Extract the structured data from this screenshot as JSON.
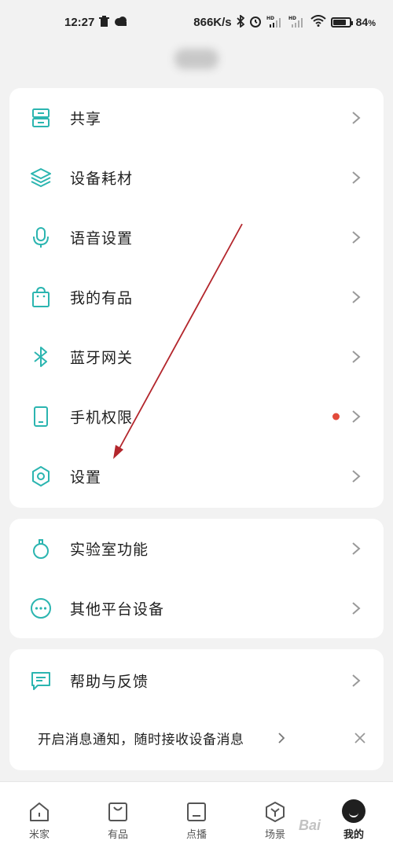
{
  "status_bar": {
    "time": "12:27",
    "speed": "866K/s",
    "battery_pct": "84",
    "battery_unit": "%",
    "battery_level": 0.84,
    "icons": [
      "trash-icon",
      "cloud-icon",
      "bluetooth-icon",
      "alarm-icon",
      "signal-hd-icon",
      "signal-hd-icon",
      "wifi-icon",
      "battery-icon"
    ]
  },
  "menu_card_1": {
    "items": [
      {
        "label": "共享",
        "icon": "share-cabinet-icon"
      },
      {
        "label": "设备耗材",
        "icon": "layers-icon"
      },
      {
        "label": "语音设置",
        "icon": "microphone-icon"
      },
      {
        "label": "我的有品",
        "icon": "shopping-bag-icon"
      },
      {
        "label": "蓝牙网关",
        "icon": "bluetooth-icon"
      },
      {
        "label": "手机权限",
        "icon": "phone-icon",
        "badge": "red-dot"
      },
      {
        "label": "设置",
        "icon": "hexagon-settings-icon"
      }
    ]
  },
  "menu_card_2": {
    "items": [
      {
        "label": "实验室功能",
        "icon": "flask-icon"
      },
      {
        "label": "其他平台设备",
        "icon": "more-dots-icon"
      }
    ]
  },
  "menu_card_3": {
    "items": [
      {
        "label": "帮助与反馈",
        "icon": "feedback-message-icon"
      }
    ],
    "notification": "开启消息通知，随时接收设备消息"
  },
  "bottom_nav": {
    "items": [
      {
        "label": "米家",
        "icon": "home-icon"
      },
      {
        "label": "有品",
        "icon": "bag-icon"
      },
      {
        "label": "点播",
        "icon": "tv-icon"
      },
      {
        "label": "场景",
        "icon": "scene-cube-icon"
      },
      {
        "label": "我的",
        "icon": "avatar-icon",
        "active": true
      }
    ]
  },
  "watermark": "Bai",
  "colors": {
    "accent": "#2bb5b0",
    "red_dot": "#e24a3b",
    "annotation_arrow": "#b3262c"
  }
}
